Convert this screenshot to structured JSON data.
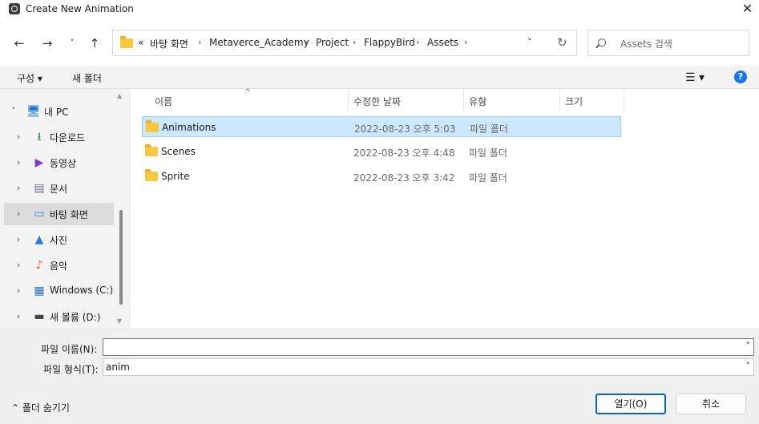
{
  "window": {
    "title": "Create New Animation",
    "close_glyph": "✕"
  },
  "nav": {
    "back": "←",
    "forward": "→",
    "recent": "˅",
    "up": "↑",
    "overflow": "«",
    "breadcrumbs": [
      "바탕 화면",
      "Metaverce_Academy",
      "Project",
      "FlappyBird",
      "Assets"
    ],
    "separator": "›",
    "dropdown": "˅",
    "refresh": "↻",
    "search_placeholder": "Assets 검색"
  },
  "toolbar": {
    "organize": "구성 ▾",
    "new_folder": "새 폴더",
    "view": "☰ ▾",
    "help": "?"
  },
  "sidebar": {
    "items": [
      {
        "label": "내 PC",
        "chevron": "˅",
        "icon": "pc-icon",
        "glyph": "🖥"
      },
      {
        "label": "다운로드",
        "chevron": "›",
        "icon": "download-icon",
        "glyph": "⭳"
      },
      {
        "label": "동영상",
        "chevron": "›",
        "icon": "video-icon",
        "glyph": "▶"
      },
      {
        "label": "문서",
        "chevron": "›",
        "icon": "document-icon",
        "glyph": "▤"
      },
      {
        "label": "바탕 화면",
        "chevron": "›",
        "icon": "desktop-icon",
        "glyph": "▭"
      },
      {
        "label": "사진",
        "chevron": "›",
        "icon": "pictures-icon",
        "glyph": "▲"
      },
      {
        "label": "음악",
        "chevron": "›",
        "icon": "music-icon",
        "glyph": "♪"
      },
      {
        "label": "Windows (C:)",
        "chevron": "›",
        "icon": "drive-c-icon",
        "glyph": "▦"
      },
      {
        "label": "새 볼륨 (D:)",
        "chevron": "›",
        "icon": "drive-d-icon",
        "glyph": "▬"
      }
    ],
    "selected_index": 4,
    "scroll_up": "▲",
    "scroll_down": "▼"
  },
  "columns": {
    "name": "이름",
    "date": "수정한 날짜",
    "type": "유형",
    "size": "크기",
    "sort_glyph": "^"
  },
  "files": [
    {
      "name": "Animations",
      "date": "2022-08-23 오후 5:03",
      "type": "파일 폴더"
    },
    {
      "name": "Scenes",
      "date": "2022-08-23 오후 4:48",
      "type": "파일 폴더"
    },
    {
      "name": "Sprite",
      "date": "2022-08-23 오후 3:42",
      "type": "파일 폴더"
    }
  ],
  "form": {
    "filename_label": "파일 이름(N):",
    "filename_value": "",
    "filetype_label": "파일 형식(T):",
    "filetype_value": "anim",
    "dropdown_glyph": "˅"
  },
  "footer": {
    "hide_folders": "⌃  폴더 숨기기",
    "open": "열기(O)",
    "cancel": "취소"
  },
  "colors": {
    "selection": "#cce8ff",
    "accent": "#0067c0",
    "folder": "#f8c93e"
  }
}
